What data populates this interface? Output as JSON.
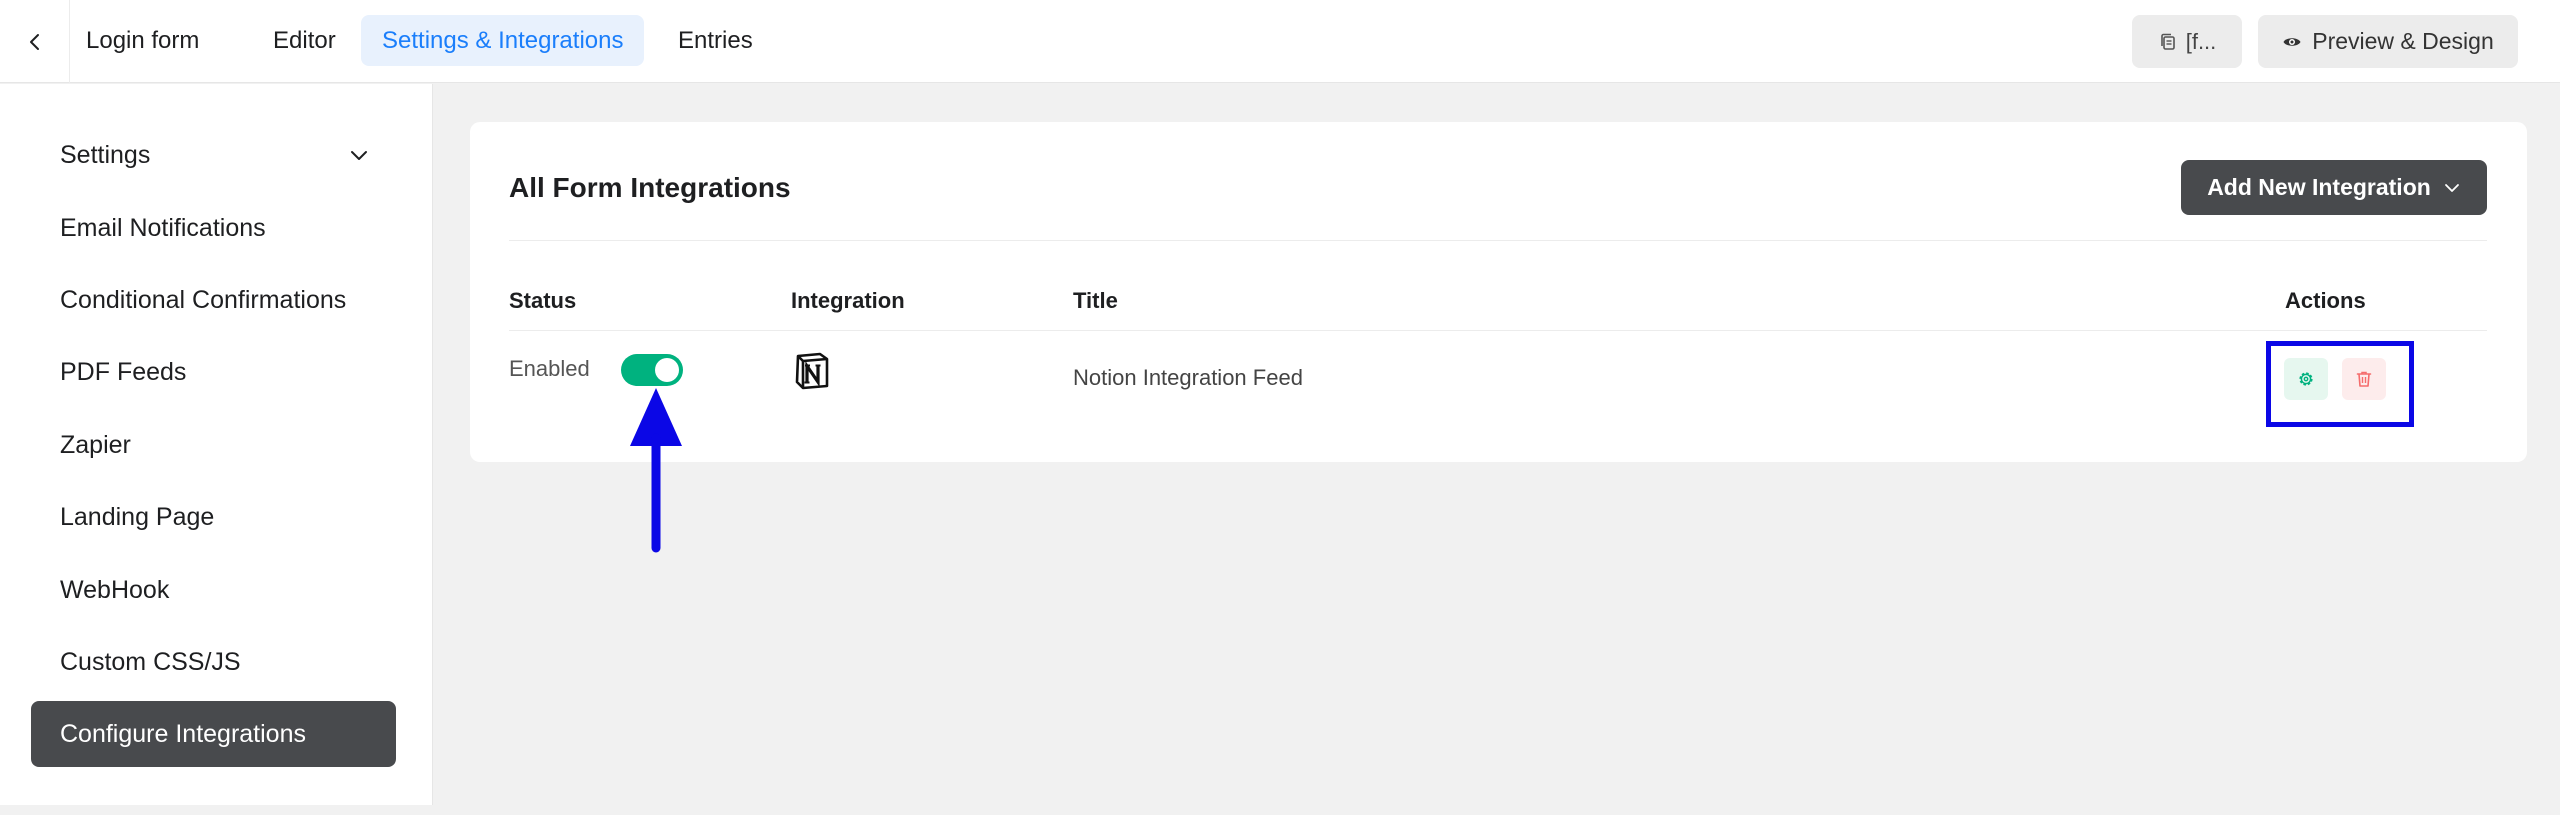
{
  "header": {
    "form_name": "Login form",
    "tabs": [
      {
        "label": "Editor",
        "active": false
      },
      {
        "label": "Settings & Integrations",
        "active": true
      },
      {
        "label": "Entries",
        "active": false
      }
    ],
    "shortcode_label": "[f...",
    "preview_label": "Preview & Design"
  },
  "sidebar": {
    "items": [
      {
        "label": "Settings",
        "active": false
      },
      {
        "label": "Email Notifications",
        "active": false
      },
      {
        "label": "Conditional Confirmations",
        "active": false
      },
      {
        "label": "PDF Feeds",
        "active": false
      },
      {
        "label": "Zapier",
        "active": false
      },
      {
        "label": "Landing Page",
        "active": false
      },
      {
        "label": "WebHook",
        "active": false
      },
      {
        "label": "Custom CSS/JS",
        "active": false
      },
      {
        "label": "Configure Integrations",
        "active": true
      }
    ]
  },
  "main": {
    "title": "All Form Integrations",
    "add_button_label": "Add New Integration",
    "table": {
      "headers": {
        "status": "Status",
        "integration": "Integration",
        "title": "Title",
        "actions": "Actions"
      },
      "rows": [
        {
          "status": "Enabled",
          "enabled": true,
          "integration_icon": "notion-logo",
          "title": "Notion Integration Feed"
        }
      ]
    }
  },
  "colors": {
    "accent": "#1a7efb",
    "toggle_on": "#00b27f",
    "dark_button": "#484a4d",
    "annotation": "#0b07e6",
    "delete": "#f56c6c",
    "settings_action": "#00b27f"
  }
}
